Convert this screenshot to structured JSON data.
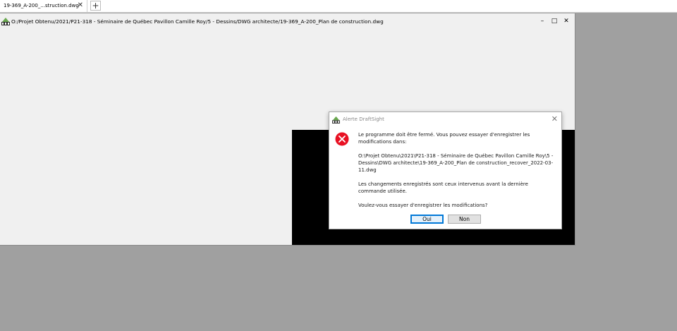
{
  "tabs": [
    {
      "label": "19-369_A-200_...struction.dwg"
    }
  ],
  "tab_close_glyph": "✕",
  "tab_new_glyph": "+",
  "window": {
    "title": "O:/Projet Obtenu/2021/P21-318 - Séminaire de Québec Pavillon Camille Roy/5 - Dessins/DWG architecte/19-369_A-200_Plan de construction.dwg",
    "minimize_glyph": "–",
    "maximize_glyph": "□",
    "close_glyph": "✕"
  },
  "dialog": {
    "title": "Alerte DraftSight",
    "close_glyph": "✕",
    "message1": "Le programme doit être fermé. Vous pouvez essayer d'enregistrer les modifications dans:",
    "path": "O:\\Projet Obtenu\\2021\\P21-318 - Séminaire de Québec Pavillon Camille Roy\\5 - Dessins\\DWG architecte\\19-369_A-200_Plan de construction_recover_2022-03-11.dwg",
    "message2": "Les changements enregistrés sont ceux intervenus avant la dernière commande utilisée.",
    "question": "Voulez-vous essayer d'enregistrer les modifications?",
    "yes_label": "Oui",
    "no_label": "Non"
  },
  "colors": {
    "desktop": "#a0a0a0",
    "window_bg": "#f0f0f0",
    "error_red": "#e81123",
    "button_focus": "#0078d7",
    "drawing_area": "#000000"
  },
  "icons": {
    "app": "draftsight-app-icon",
    "error": "error-circle-icon"
  }
}
